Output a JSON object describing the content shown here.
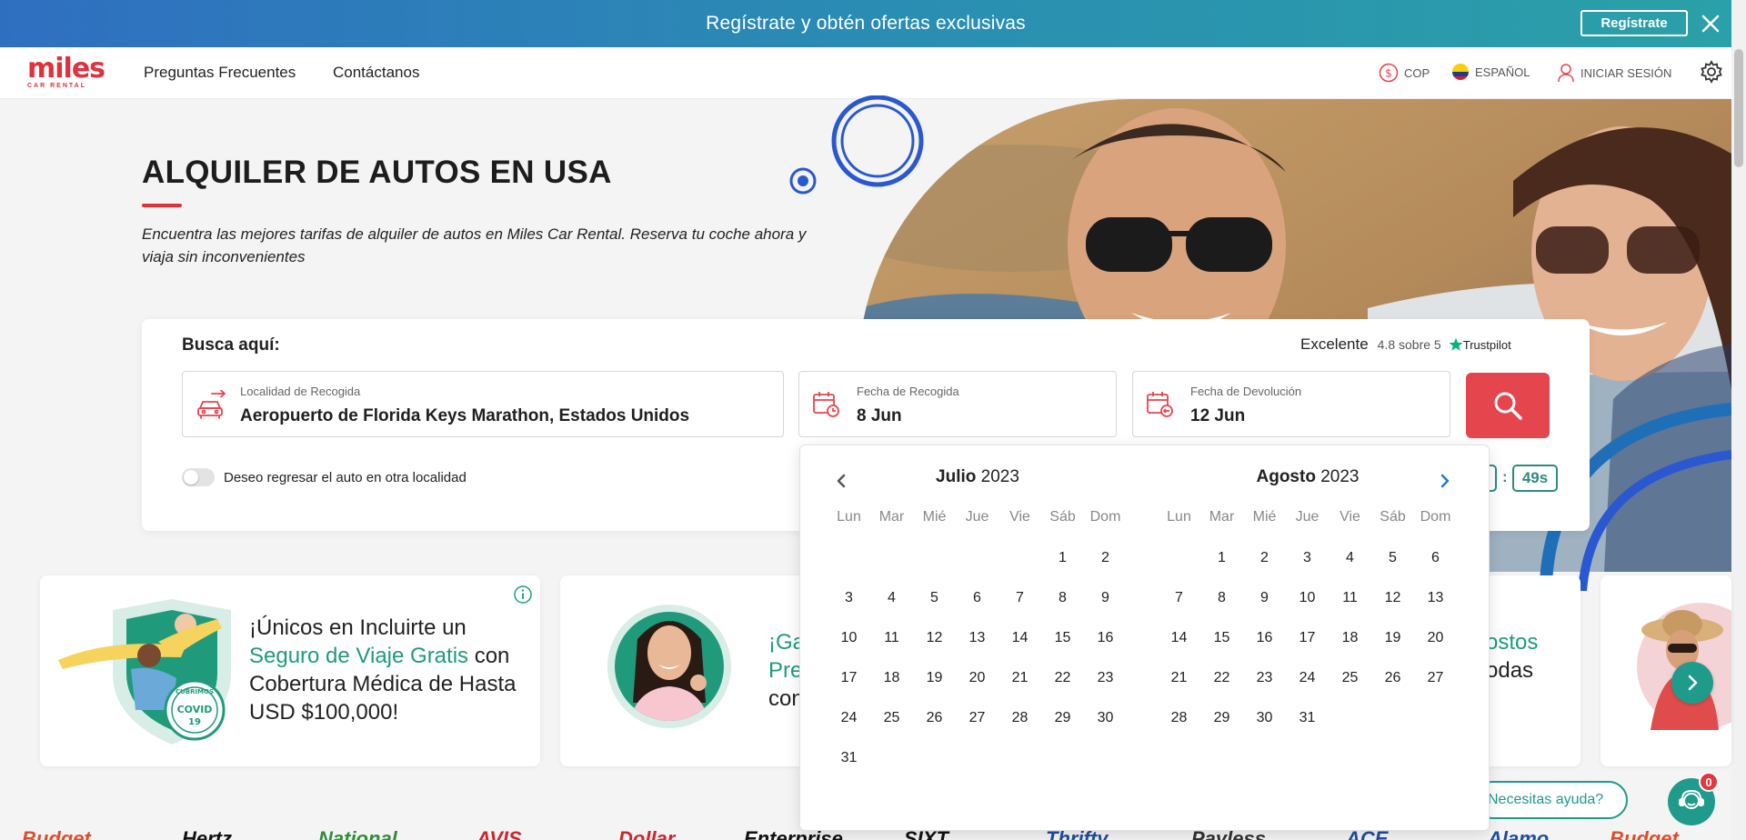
{
  "promo_banner": {
    "text": "Regístrate y obtén ofertas exclusivas",
    "button": "Regístrate"
  },
  "nav": {
    "logo_text": "miles",
    "logo_sub": "CAR RENTAL",
    "links": [
      "Preguntas Frecuentes",
      "Contáctanos"
    ],
    "currency": "COP",
    "language": "ESPAÑOL",
    "login": "INICIAR SESIÓN"
  },
  "hero": {
    "title": "ALQUILER DE AUTOS EN USA",
    "subtitle": "Encuentra las mejores tarifas de alquiler de autos en Miles Car Rental. Reserva tu coche ahora y viaja sin inconvenientes"
  },
  "search": {
    "label": "Busca aquí:",
    "trust_label": "Excelente",
    "trust_score": "4.8 sobre 5",
    "trust_brand": "Trustpilot",
    "pickup_location_label": "Localidad de Recogida",
    "pickup_location_value": "Aeropuerto de Florida Keys Marathon, Estados Unidos",
    "pickup_date_label": "Fecha de Recogida",
    "pickup_date_value": "8 Jun",
    "return_date_label": "Fecha de Devolución",
    "return_date_value": "12 Jun",
    "return_other_location": "Deseo regresar el auto en otra localidad",
    "return_other_location_on": false,
    "timer_colon": ":",
    "timer_seconds": "49s"
  },
  "calendar": {
    "weekdays": [
      "Lun",
      "Mar",
      "Mié",
      "Jue",
      "Vie",
      "Sáb",
      "Dom"
    ],
    "months": [
      {
        "name": "Julio",
        "year": "2023",
        "days": [
          "",
          "",
          "",
          "",
          "",
          "1",
          "2",
          "3",
          "4",
          "5",
          "6",
          "7",
          "8",
          "9",
          "10",
          "11",
          "12",
          "13",
          "14",
          "15",
          "16",
          "17",
          "18",
          "19",
          "20",
          "21",
          "22",
          "23",
          "24",
          "25",
          "26",
          "27",
          "28",
          "29",
          "30",
          "31"
        ]
      },
      {
        "name": "Agosto",
        "year": "2023",
        "days": [
          "",
          "1",
          "2",
          "3",
          "4",
          "5",
          "6",
          "7",
          "8",
          "9",
          "10",
          "11",
          "12",
          "13",
          "14",
          "15",
          "16",
          "17",
          "18",
          "19",
          "20",
          "21",
          "22",
          "23",
          "24",
          "25",
          "26",
          "27",
          "28",
          "29",
          "30",
          "31"
        ]
      }
    ]
  },
  "promo_cards": {
    "card1": {
      "pre": "¡Únicos en Incluirte un ",
      "highlight": "Seguro de Viaje Gratis",
      "post": " con Cobertura Médica de Hasta USD $100,000!",
      "badge_top": "CUBRIMOS",
      "badge_main": "COVID",
      "badge_num": "19"
    },
    "card2": {
      "line1": "¡Ga",
      "line2": "Pre",
      "line3": "con"
    },
    "card3": {
      "line1": "ostos",
      "line2": "odas"
    }
  },
  "help": {
    "label": "Necesitas ayuda?",
    "badge": "0"
  },
  "brands": [
    "Budget",
    "Hertz",
    "National",
    "AVIS",
    "Dollar",
    "Enterprise",
    "SIXT",
    "Thrifty",
    "Payless",
    "ACE",
    "Alamo",
    "Budget"
  ],
  "colors": {
    "accent_red": "#e5454d",
    "brand_teal": "#1f9b8c",
    "banner_blue": "#2f6fc0"
  }
}
